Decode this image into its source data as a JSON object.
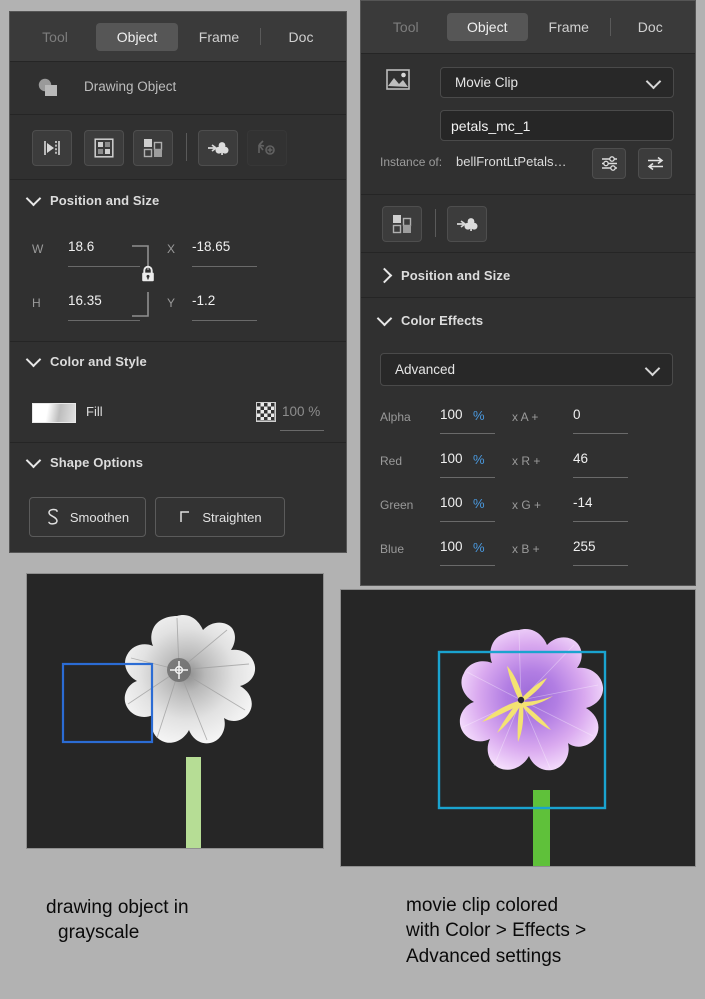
{
  "left_panel": {
    "tabs": [
      {
        "label": "Tool",
        "state": "disabled"
      },
      {
        "label": "Object",
        "state": "active"
      },
      {
        "label": "Frame",
        "state": "normal"
      },
      {
        "label": "Doc",
        "state": "normal"
      }
    ],
    "object_type": "Drawing Object",
    "toolbar_icons": [
      {
        "name": "flip-horizontal-icon",
        "enabled": true
      },
      {
        "name": "align-icon",
        "enabled": true
      },
      {
        "name": "arrange-icon",
        "enabled": true
      },
      {
        "name": "convert-to-symbol-icon",
        "enabled": true
      },
      {
        "name": "break-apart-icon",
        "enabled": false
      }
    ],
    "position_and_size": {
      "title": "Position and Size",
      "expanded": true,
      "w_label": "W",
      "w_value": "18.6",
      "h_label": "H",
      "h_value": "16.35",
      "x_label": "X",
      "x_value": "-18.65",
      "y_label": "Y",
      "y_value": "-1.2",
      "lock_icon": "lock-icon"
    },
    "color_and_style": {
      "title": "Color and Style",
      "expanded": true,
      "fill_label": "Fill",
      "alpha_value": "100 %"
    },
    "shape_options": {
      "title": "Shape Options",
      "expanded": true,
      "smoothen_label": "Smoothen",
      "straighten_label": "Straighten"
    }
  },
  "right_panel": {
    "tabs": [
      {
        "label": "Tool",
        "state": "disabled"
      },
      {
        "label": "Object",
        "state": "active"
      },
      {
        "label": "Frame",
        "state": "normal"
      },
      {
        "label": "Doc",
        "state": "normal"
      }
    ],
    "symbol_type": "Movie Clip",
    "instance_name": "petals_mc_1",
    "instance_of_label": "Instance of:",
    "instance_of_value": "bellFrontLtPetals…",
    "toolbar_icons": [
      {
        "name": "arrange-icon",
        "enabled": true
      },
      {
        "name": "convert-to-symbol-icon",
        "enabled": true
      }
    ],
    "position_and_size": {
      "title": "Position and Size",
      "expanded": false
    },
    "color_effects": {
      "title": "Color Effects",
      "expanded": true,
      "mode": "Advanced",
      "rows": [
        {
          "label": "Alpha",
          "percent": "100",
          "percent_unit": "%",
          "mult": "x A +",
          "offset": "0"
        },
        {
          "label": "Red",
          "percent": "100",
          "percent_unit": "%",
          "mult": "x R +",
          "offset": "46"
        },
        {
          "label": "Green",
          "percent": "100",
          "percent_unit": "%",
          "mult": "x G +",
          "offset": "-14"
        },
        {
          "label": "Blue",
          "percent": "100",
          "percent_unit": "%",
          "mult": "x B +",
          "offset": "255"
        }
      ]
    }
  },
  "figures": [
    {
      "name": "grayscale-flower-stage",
      "caption": "drawing object in\ngrayscale",
      "caption_line1": "drawing object in",
      "caption_line2": "grayscale",
      "selection_color": "#2b6cd4",
      "stem_color": "#b6dd95"
    },
    {
      "name": "colored-flower-stage",
      "caption": "movie clip colored\nwith Color > Effects >\nAdvanced settings",
      "caption_line1": "movie clip colored",
      "caption_line2": "with Color > Effects >",
      "caption_line3": "Advanced settings",
      "selection_color": "#1aa3cf",
      "stem_color": "#5fc13a",
      "petal_color": "#b07ee0",
      "stamen_color": "#f2e06a"
    }
  ],
  "colors": {
    "panel_bg": "#303030",
    "panel_header": "#3a3a3a",
    "page_bg": "#b2b2b2",
    "accent_blue": "#4a9ae0",
    "stage_bg": "#262626"
  }
}
